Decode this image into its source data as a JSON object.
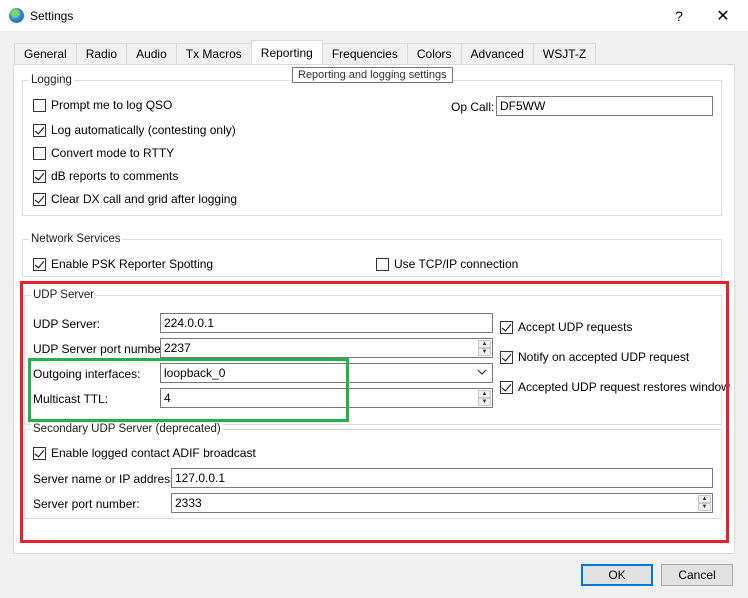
{
  "window": {
    "title": "Settings",
    "help_label": "?",
    "close_label": "✕"
  },
  "tabs": [
    {
      "label": "General"
    },
    {
      "label": "Radio"
    },
    {
      "label": "Audio"
    },
    {
      "label": "Tx Macros"
    },
    {
      "label": "Reporting",
      "active": true
    },
    {
      "label": "Frequencies"
    },
    {
      "label": "Colors"
    },
    {
      "label": "Advanced"
    },
    {
      "label": "WSJT-Z"
    }
  ],
  "tooltip": "Reporting and logging settings",
  "logging": {
    "title": "Logging",
    "prompt_qso": {
      "label": "Prompt me to log QSO",
      "checked": false
    },
    "log_auto": {
      "label": "Log automatically (contesting only)",
      "checked": true
    },
    "convert_rtty": {
      "label": "Convert mode to RTTY",
      "checked": false
    },
    "db_reports": {
      "label": "dB reports to comments",
      "checked": true
    },
    "clear_dx": {
      "label": "Clear DX call and grid after logging",
      "checked": true
    },
    "op_call_label": "Op Call:",
    "op_call_value": "DF5WW"
  },
  "network": {
    "title": "Network Services",
    "psk_reporter": {
      "label": "Enable PSK Reporter Spotting",
      "checked": true
    },
    "tcp_ip": {
      "label": "Use TCP/IP connection",
      "checked": false
    }
  },
  "udp": {
    "title": "UDP Server",
    "server_label": "UDP Server:",
    "server_value": "224.0.0.1",
    "port_label": "UDP Server port number:",
    "port_value": "2237",
    "interfaces_label": "Outgoing interfaces:",
    "interfaces_value": "loopback_0",
    "ttl_label": "Multicast TTL:",
    "ttl_value": "4",
    "accept": {
      "label": "Accept UDP requests",
      "checked": true
    },
    "notify": {
      "label": "Notify on accepted UDP request",
      "checked": true
    },
    "restore": {
      "label": "Accepted UDP request restores window",
      "checked": true
    }
  },
  "secondary": {
    "title": "Secondary UDP Server (deprecated)",
    "adif": {
      "label": "Enable logged contact ADIF broadcast",
      "checked": true
    },
    "server_label": "Server name or IP address:",
    "server_value": "127.0.0.1",
    "port_label": "Server port number:",
    "port_value": "2333"
  },
  "buttons": {
    "ok": "OK",
    "cancel": "Cancel"
  },
  "colors": {
    "highlight_red": "#e8202a",
    "highlight_green": "#22b14c",
    "default_button_border": "#0078d7"
  },
  "icons": {
    "app": "globe-icon",
    "spin_up": "▲",
    "spin_down": "▼",
    "combo": "chevron-down-icon"
  }
}
